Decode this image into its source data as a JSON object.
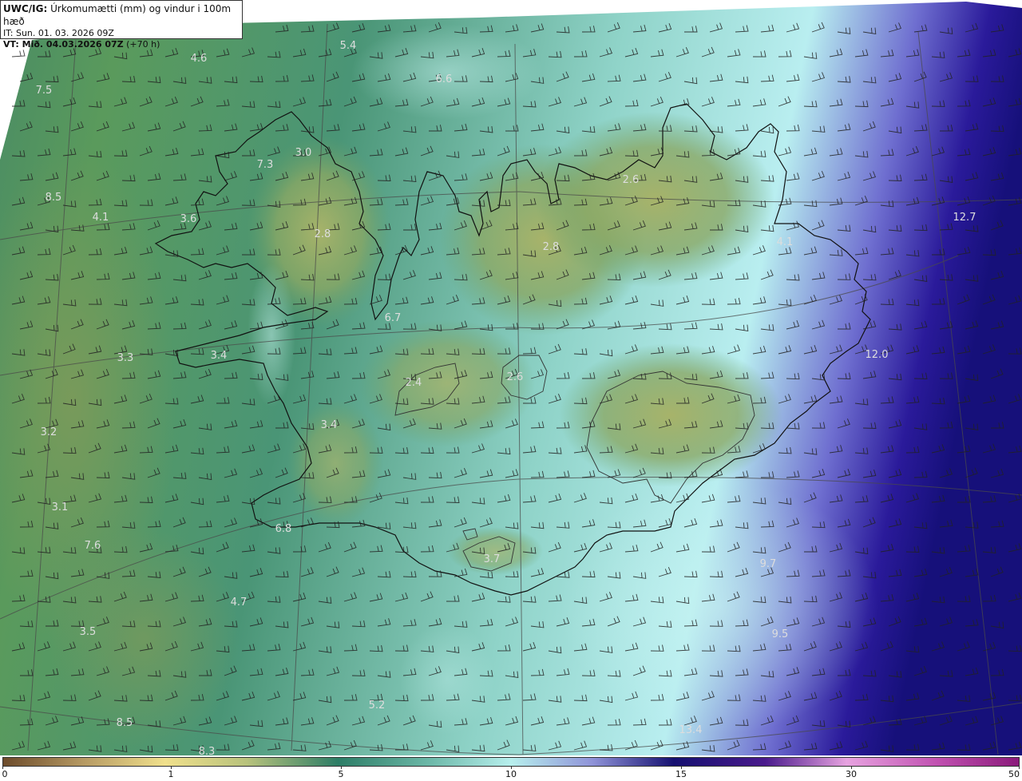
{
  "header": {
    "model": "UWC/IG:",
    "product": " Úrkomumætti (mm) og vindur i 100m hæð",
    "init_time": "IT: Sun. 01. 03. 2026 09Z",
    "valid_label": "VT: Mið. 04.03.2026 07Z",
    "lead_time": " (+70 h)"
  },
  "colorbar": {
    "ticks": [
      "0",
      "1",
      "5",
      "10",
      "15",
      "30",
      "50"
    ]
  },
  "value_labels": [
    "5.4",
    "4.6",
    "7.5",
    "6.6",
    "7.3",
    "3.0",
    "8.5",
    "4.1",
    "3.6",
    "2.8",
    "2.6",
    "2.8",
    "4.1",
    "12.7",
    "6.7",
    "3.4",
    "3.3",
    "2.4",
    "2.6",
    "12.0",
    "3.2",
    "3.4",
    "3.1",
    "6.8",
    "7.6",
    "3.7",
    "9.7",
    "4.7",
    "3.5",
    "9.5",
    "5.2",
    "8.5",
    "13.4",
    "8.3"
  ],
  "colors": {
    "land_low": "#93a862",
    "land_mid": "#5e9a6c",
    "sea_teal": "#3f8a72",
    "sea_light": "#9fdcd5",
    "sea_blue": "#4f4fb8",
    "sea_dark": "#1a0f80",
    "coast": "#111111",
    "barb": "#222222",
    "label": "#dddddd"
  }
}
